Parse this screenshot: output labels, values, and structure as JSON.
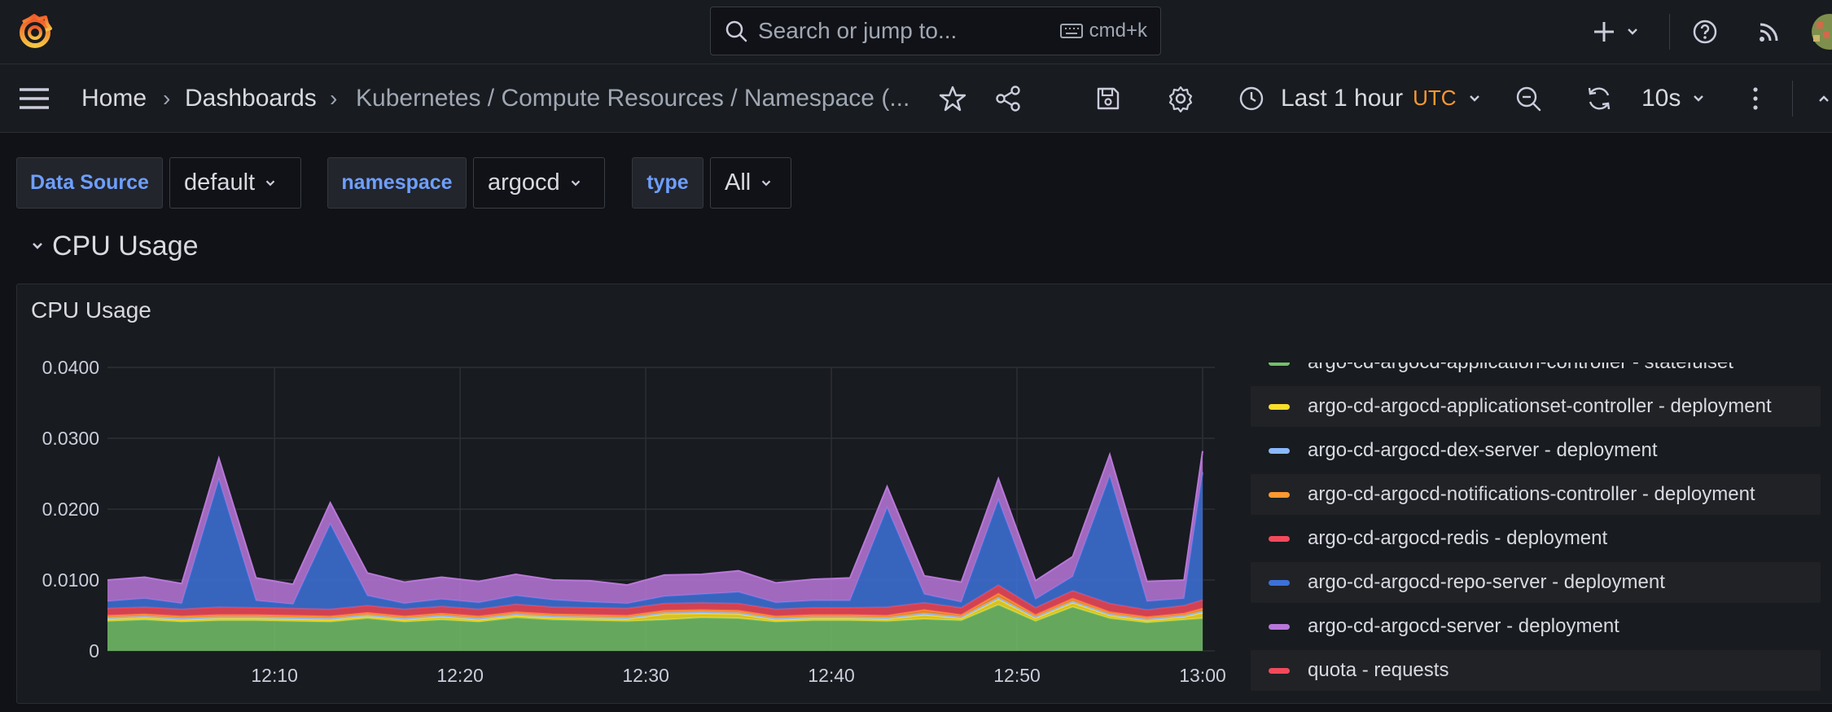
{
  "topbar": {
    "search_placeholder": "Search or jump to...",
    "shortcut": "cmd+k",
    "icons": [
      "grafana-logo-icon",
      "plus-icon",
      "help-icon",
      "rss-icon",
      "user-avatar"
    ]
  },
  "navbar": {
    "breadcrumbs": [
      "Home",
      "Dashboards",
      "Kubernetes / Compute Resources / Namespace (..."
    ],
    "time_range": "Last 1 hour",
    "timezone": "UTC",
    "refresh_interval": "10s"
  },
  "variables": [
    {
      "label": "Data Source",
      "value": "default"
    },
    {
      "label": "namespace",
      "value": "argocd"
    },
    {
      "label": "type",
      "value": "All"
    }
  ],
  "row": {
    "title": "CPU Usage"
  },
  "panel": {
    "title": "CPU Usage"
  },
  "chart_data": {
    "type": "area",
    "stacked": true,
    "title": "CPU Usage",
    "xlabel": "",
    "ylabel": "",
    "ylim": [
      0,
      0.04
    ],
    "x_ticks": [
      "12:10",
      "12:20",
      "12:30",
      "12:40",
      "12:50",
      "13:00"
    ],
    "y_ticks": [
      "0",
      "0.0100",
      "0.0200",
      "0.0300",
      "0.0400"
    ],
    "x_range": [
      "12:01",
      "13:00"
    ],
    "x": [
      "12:01",
      "12:03",
      "12:05",
      "12:07",
      "12:09",
      "12:11",
      "12:13",
      "12:15",
      "12:17",
      "12:19",
      "12:21",
      "12:23",
      "12:25",
      "12:27",
      "12:29",
      "12:31",
      "12:33",
      "12:35",
      "12:37",
      "12:39",
      "12:41",
      "12:43",
      "12:45",
      "12:47",
      "12:49",
      "12:51",
      "12:53",
      "12:55",
      "12:57",
      "12:59",
      "13:00"
    ],
    "grid": true,
    "legend_position": "right",
    "series": [
      {
        "name": "argo-cd-argocd-application-controller - statefulset",
        "color": "#73bf69",
        "values": [
          0.0042,
          0.0044,
          0.0041,
          0.0043,
          0.0043,
          0.0042,
          0.0041,
          0.0046,
          0.0041,
          0.0044,
          0.0041,
          0.0047,
          0.0044,
          0.0043,
          0.0042,
          0.0044,
          0.0047,
          0.0046,
          0.0041,
          0.0043,
          0.0043,
          0.0042,
          0.0045,
          0.0043,
          0.0065,
          0.0042,
          0.0062,
          0.0046,
          0.004,
          0.0044,
          0.0046
        ]
      },
      {
        "name": "argo-cd-argocd-applicationset-controller - deployment",
        "color": "#fade2a",
        "values": [
          0.0003,
          0.0003,
          0.0003,
          0.0003,
          0.0003,
          0.0003,
          0.0003,
          0.0003,
          0.0003,
          0.0004,
          0.0003,
          0.0003,
          0.0003,
          0.0003,
          0.0003,
          0.0008,
          0.0006,
          0.0006,
          0.0003,
          0.0003,
          0.0003,
          0.0003,
          0.0006,
          0.0003,
          0.0008,
          0.0004,
          0.0006,
          0.0004,
          0.0003,
          0.0004,
          0.0008
        ]
      },
      {
        "name": "argo-cd-argocd-dex-server - deployment",
        "color": "#8ab8ff",
        "values": [
          0.0002,
          0.0002,
          0.0002,
          0.0002,
          0.0002,
          0.0002,
          0.0002,
          0.0002,
          0.0002,
          0.0002,
          0.0002,
          0.0002,
          0.0002,
          0.0002,
          0.0002,
          0.0002,
          0.0002,
          0.0002,
          0.0002,
          0.0002,
          0.0002,
          0.0002,
          0.0002,
          0.0002,
          0.0002,
          0.0002,
          0.0002,
          0.0002,
          0.0002,
          0.0002,
          0.0002
        ]
      },
      {
        "name": "argo-cd-argocd-notifications-controller - deployment",
        "color": "#ff9830",
        "values": [
          0.0003,
          0.0003,
          0.0003,
          0.0003,
          0.0003,
          0.0003,
          0.0003,
          0.0003,
          0.0003,
          0.0003,
          0.0003,
          0.0003,
          0.0003,
          0.0003,
          0.0003,
          0.0003,
          0.0003,
          0.0003,
          0.0003,
          0.0003,
          0.0003,
          0.0003,
          0.0005,
          0.0003,
          0.0006,
          0.0003,
          0.0004,
          0.0003,
          0.0003,
          0.0003,
          0.0004
        ]
      },
      {
        "name": "argo-cd-argocd-redis - deployment",
        "color": "#f2495c",
        "values": [
          0.001,
          0.001,
          0.001,
          0.0011,
          0.001,
          0.001,
          0.001,
          0.001,
          0.001,
          0.001,
          0.001,
          0.0011,
          0.001,
          0.001,
          0.001,
          0.001,
          0.001,
          0.001,
          0.001,
          0.001,
          0.001,
          0.0012,
          0.001,
          0.001,
          0.0012,
          0.001,
          0.0011,
          0.0012,
          0.001,
          0.0011,
          0.0012
        ]
      },
      {
        "name": "argo-cd-argocd-repo-server - deployment",
        "color": "#3d71d9",
        "values": [
          0.001,
          0.0012,
          0.0008,
          0.018,
          0.001,
          0.0006,
          0.012,
          0.0014,
          0.0008,
          0.001,
          0.0009,
          0.0012,
          0.001,
          0.0008,
          0.0007,
          0.001,
          0.0012,
          0.0016,
          0.0009,
          0.001,
          0.001,
          0.014,
          0.0012,
          0.0008,
          0.012,
          0.0012,
          0.002,
          0.018,
          0.0012,
          0.001,
          0.018
        ]
      },
      {
        "name": "argo-cd-argocd-server - deployment",
        "color": "#b877d9",
        "values": [
          0.003,
          0.003,
          0.0028,
          0.003,
          0.0032,
          0.0028,
          0.003,
          0.0032,
          0.003,
          0.0031,
          0.003,
          0.003,
          0.0028,
          0.003,
          0.0026,
          0.003,
          0.0028,
          0.003,
          0.0028,
          0.003,
          0.0032,
          0.003,
          0.0026,
          0.0028,
          0.003,
          0.0026,
          0.0028,
          0.003,
          0.0028,
          0.0026,
          0.003
        ]
      },
      {
        "name": "quota - requests",
        "color": "#f2495c",
        "values": []
      }
    ]
  }
}
